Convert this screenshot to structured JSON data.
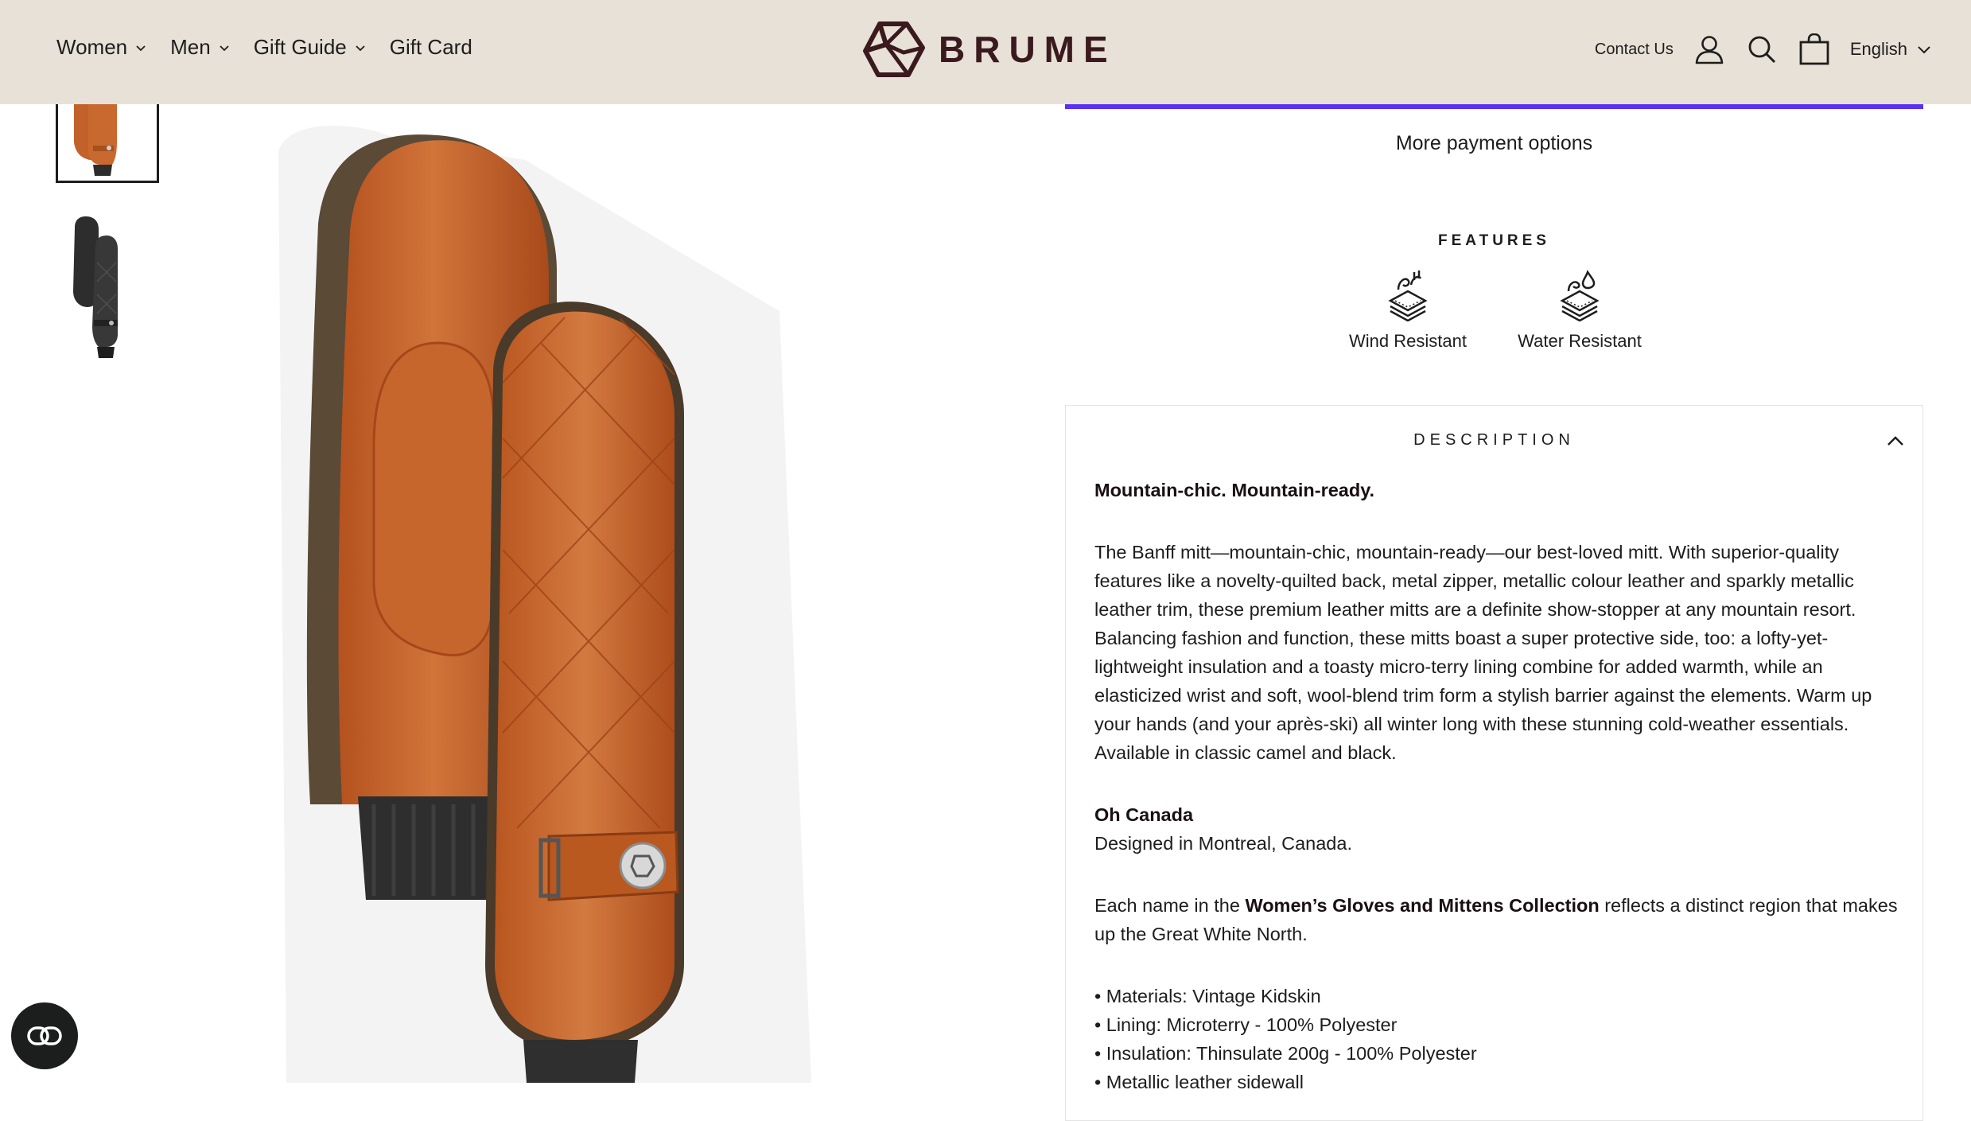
{
  "header": {
    "nav": [
      {
        "label": "Women",
        "icon": "chevron-down-icon"
      },
      {
        "label": "Men",
        "icon": "chevron-down-icon"
      },
      {
        "label": "Gift Guide",
        "icon": "chevron-down-icon"
      },
      {
        "label": "Gift Card"
      }
    ],
    "logo_text": "BRUME",
    "contact_label": "Contact Us",
    "icons": [
      "user-icon",
      "search-icon",
      "cart-icon"
    ],
    "language": "English"
  },
  "gallery": {
    "thumbnails": [
      {
        "alt": "Banff mitt in camel",
        "selected": true
      },
      {
        "alt": "Banff mitt in black",
        "selected": false
      }
    ],
    "main_image_alt": "Camel leather quilted mittens"
  },
  "payment": {
    "more_options_label": "More payment options",
    "accent_color": "#5a31f4"
  },
  "features": {
    "title": "FEATURES",
    "items": [
      {
        "label": "Wind Resistant",
        "icon": "wind-resistant-icon"
      },
      {
        "label": "Water Resistant",
        "icon": "water-resistant-icon"
      }
    ]
  },
  "description": {
    "title": "DESCRIPTION",
    "expanded": true,
    "headline": "Mountain-chic. Mountain-ready.",
    "paragraph": "The Banff mitt—mountain-chic, mountain-ready—our best-loved mitt. With superior-quality features like a novelty-quilted back, metal zipper, metallic colour leather and sparkly metallic leather trim, these premium leather mitts are a definite show-stopper at any mountain resort. Balancing fashion and function, these mitts boast a super protective side, too: a lofty-yet-lightweight insulation and a toasty micro-terry lining combine for added warmth, while an elasticized wrist and soft, wool-blend trim form a stylish barrier against the elements. Warm up your hands (and your après-ski) all winter long with these stunning cold-weather essentials. Available in classic camel and black.",
    "section_title": "Oh Canada",
    "section_text": "Designed in Montreal, Canada.",
    "collection_prefix": "Each name in the ",
    "collection_name": "Women’s Gloves and Mittens Collection",
    "collection_suffix": " reflects a distinct region that makes up the Great White North.",
    "specs": [
      "• Materials: Vintage Kidskin",
      "• Lining: Microterry - 100% Polyester",
      "• Insulation: Thinsulate 200g - 100% Polyester",
      "• Metallic leather sidewall"
    ]
  },
  "chat": {
    "icon": "accessibility-toggle-icon"
  }
}
